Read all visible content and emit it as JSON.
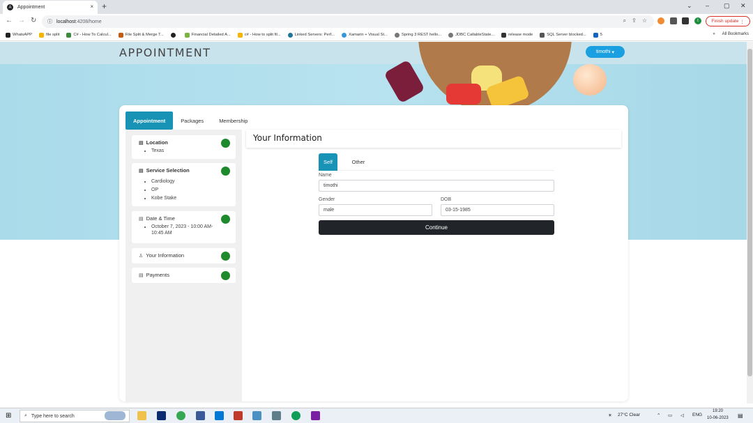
{
  "browser": {
    "tab_title": "Appointment",
    "tab_close": "×",
    "new_tab": "+",
    "url_host": "localhost",
    "url_path": ":4208/home",
    "finish_update": "Finish update",
    "profile_initial": "t",
    "window_controls": [
      "⌄",
      "–",
      "▢",
      "✕"
    ],
    "bookmarks": [
      "WhatsAPP",
      "file split",
      "C# - How To Calcul...",
      "File Split & Merge T...",
      "",
      "Financial Detailed A...",
      "c# - How to split fil...",
      "Linked Servers: Perf...",
      "Xamarin + Visual St...",
      "Spring 3 REST hello...",
      "JDBC CallableState...",
      "release mode",
      "SQL Server blocked...",
      "5"
    ],
    "bookmarks_overflow": "»",
    "all_bookmarks": "All Bookmarks"
  },
  "app": {
    "brand": "APPOINTMENT",
    "user": "timothi",
    "tabs": [
      "Appointment",
      "Packages",
      "Membership"
    ],
    "steps": {
      "location": {
        "title": "Location",
        "items": [
          "Texas"
        ]
      },
      "service": {
        "title": "Service Selection",
        "items": [
          "Cardiology",
          "OP",
          "Kobe Stake"
        ]
      },
      "datetime": {
        "title": "Date & Time",
        "items": [
          "October 7, 2023 - 10:00 AM-10:45 AM"
        ]
      },
      "info": {
        "title": "Your Information"
      },
      "payments": {
        "title": "Payments"
      }
    },
    "section_title": "Your Information",
    "subtabs": [
      "Self",
      "Other"
    ],
    "form": {
      "name_label": "Name",
      "name_value": "timothi",
      "gender_label": "Gender",
      "gender_value": "male",
      "dob_label": "DOB",
      "dob_value": "03-15-1985",
      "continue": "Continue"
    }
  },
  "taskbar": {
    "search_placeholder": "Type here to search",
    "weather": "27°C  Clear",
    "lang": "ENG",
    "time": "19:20",
    "date": "10-06-2023"
  }
}
